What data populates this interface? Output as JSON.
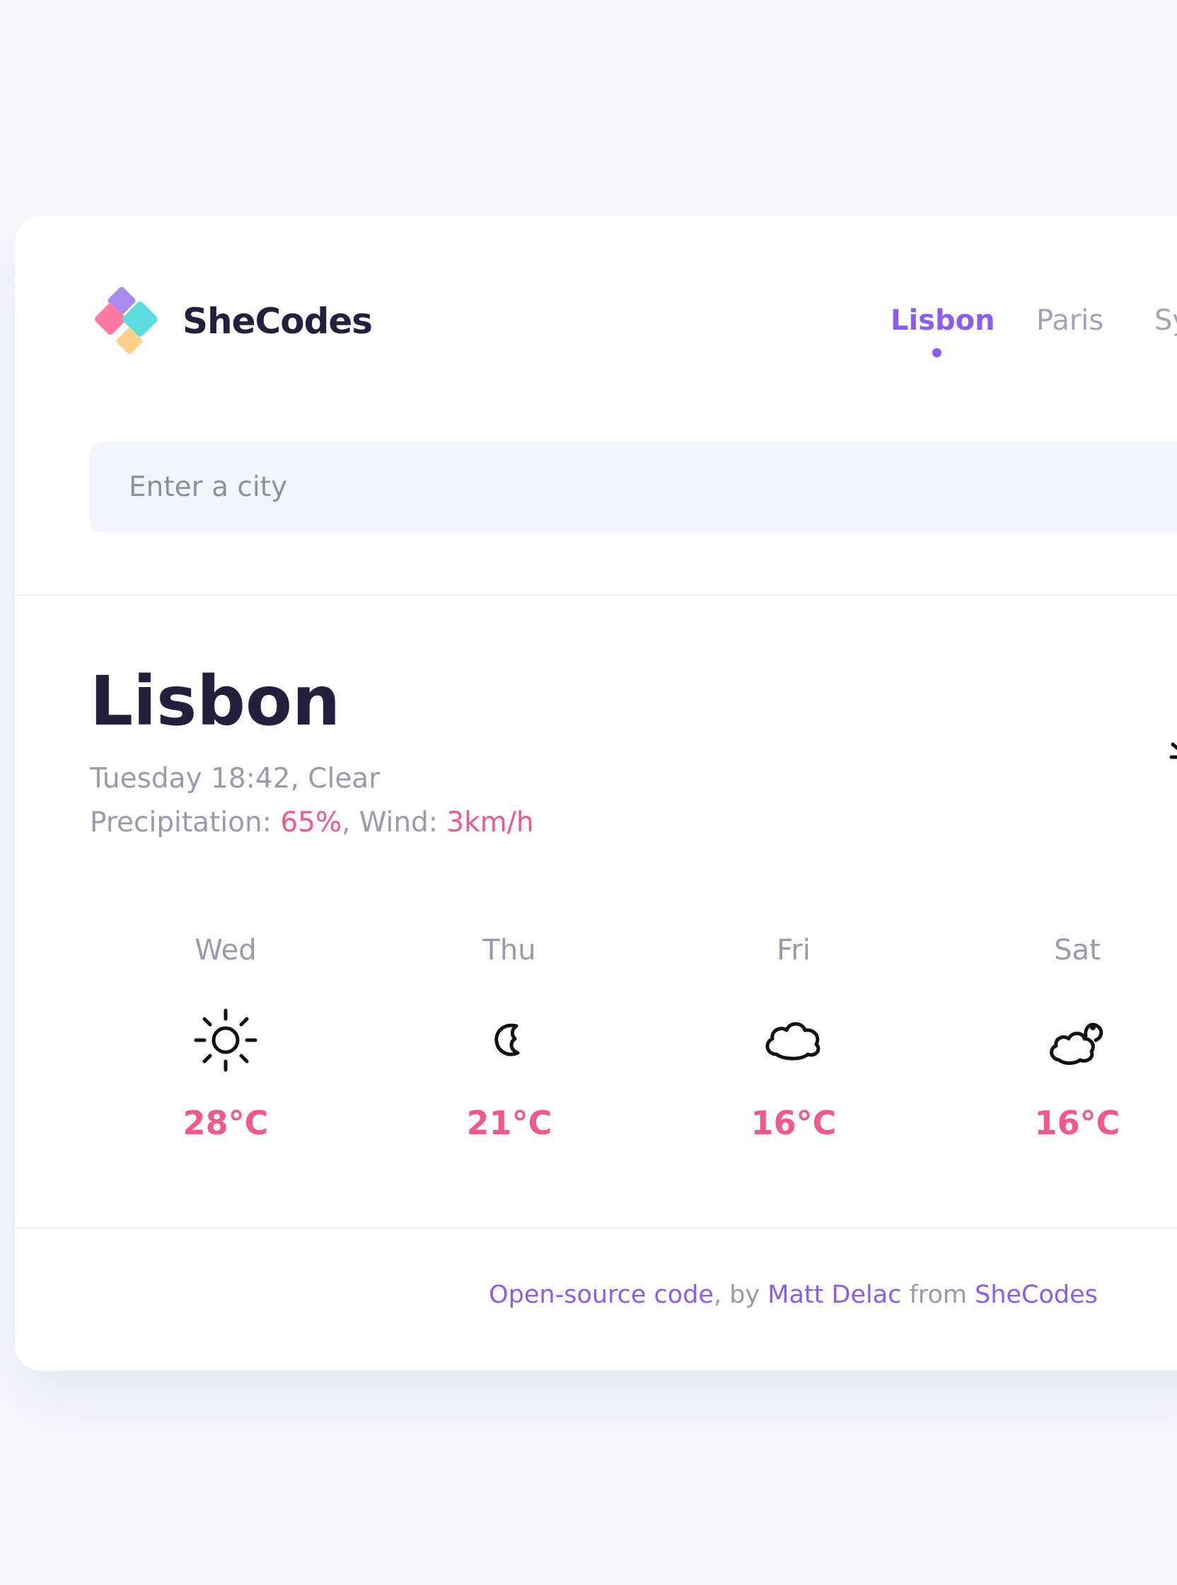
{
  "brand": {
    "name": "SheCodes",
    "colors": {
      "purple": "#a98bf0",
      "pink": "#ff7aa2",
      "teal": "#5fdce0",
      "yellow": "#ffd08a"
    }
  },
  "nav": {
    "items": [
      {
        "label": "Lisbon",
        "active": true
      },
      {
        "label": "Paris",
        "active": false
      },
      {
        "label": "Sy",
        "active": false
      }
    ],
    "active_color": "#8c5cf0"
  },
  "search": {
    "placeholder": "Enter a city"
  },
  "current": {
    "city": "Lisbon",
    "datetime_condition": "Tuesday 18:42, Clear",
    "precipitation_label": "Precipitation: ",
    "precipitation_value": "65%",
    "wind_label": ", Wind: ",
    "wind_value": "3km/h"
  },
  "forecast": [
    {
      "day": "Wed",
      "icon": "sun-icon",
      "temp": "28°C"
    },
    {
      "day": "Thu",
      "icon": "moon-icon",
      "temp": "21°C"
    },
    {
      "day": "Fri",
      "icon": "cloud-icon",
      "temp": "16°C"
    },
    {
      "day": "Sat",
      "icon": "cloud-sun-icon",
      "temp": "16°C"
    }
  ],
  "footer": {
    "code_link": "Open-source code",
    "by_text": ", by ",
    "author_link": "Matt Delac",
    "from_text": " from ",
    "org_link": "SheCodes"
  },
  "colors": {
    "accent": "#8c5cf0",
    "highlight": "#f05a8a",
    "text_dark": "#231f3d",
    "text_muted": "#9a9aaf"
  }
}
